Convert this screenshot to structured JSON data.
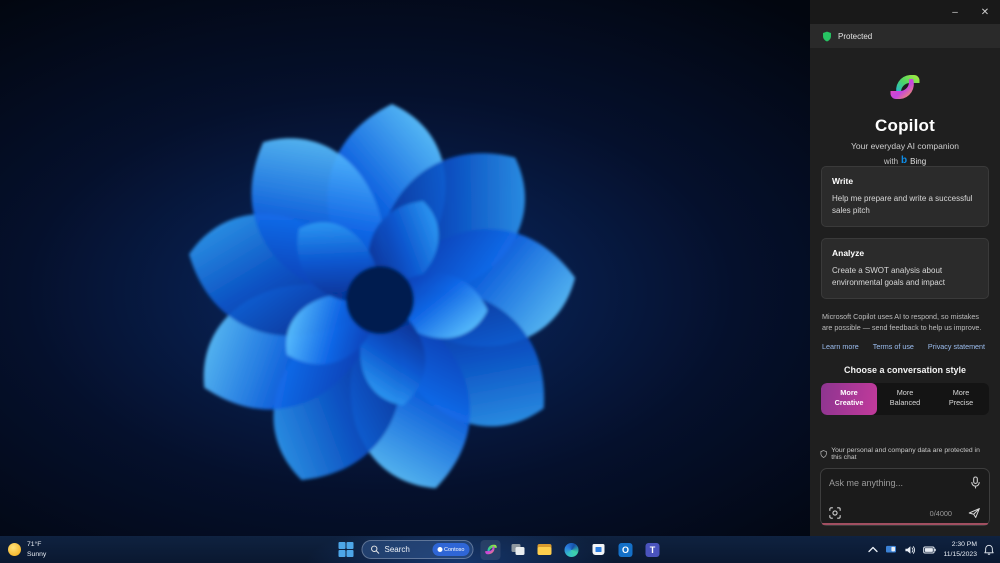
{
  "window": {
    "minimize_glyph": "–",
    "close_glyph": "✕"
  },
  "copilot": {
    "protected_label": "Protected",
    "title": "Copilot",
    "subtitle": "Your everyday AI companion",
    "with_label": "with",
    "bing_b": "b",
    "bing_label": "Bing",
    "cards": [
      {
        "title": "Write",
        "text": "Help me prepare and write a successful sales pitch"
      },
      {
        "title": "Analyze",
        "text": "Create a SWOT analysis about environmental goals and impact"
      }
    ],
    "disclaimer": "Microsoft Copilot uses AI to respond, so mistakes are possible — send feedback to help us improve.",
    "links": [
      "Learn more",
      "Terms of use",
      "Privacy statement"
    ],
    "style_heading": "Choose a conversation style",
    "styles": [
      {
        "line1": "More",
        "line2": "Creative"
      },
      {
        "line1": "More",
        "line2": "Balanced"
      },
      {
        "line1": "More",
        "line2": "Precise"
      }
    ],
    "privacy_note": "Your personal and company data are protected in this chat",
    "input": {
      "placeholder": "Ask me anything...",
      "value": "",
      "counter": "0/4000"
    }
  },
  "taskbar": {
    "weather": {
      "temp": "71°F",
      "condition": "Sunny"
    },
    "search": {
      "placeholder": "Search",
      "badge": "Contoso"
    },
    "clock": {
      "time": "2:30 PM",
      "date": "11/15/2023"
    }
  },
  "colors": {
    "protected_green": "#27c463",
    "selected_style_magenta": "#c23a9b",
    "link_blue": "#9cbef0",
    "input_underline_rose": "#a14f61",
    "bing_blue": "#0e8de8",
    "taskbar_navy": "#0c1c34"
  }
}
